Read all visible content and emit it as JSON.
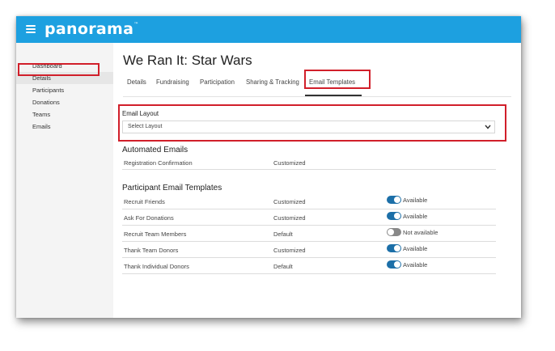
{
  "app": {
    "logo": "panorama",
    "logo_mark": "™"
  },
  "sidebar": {
    "items": [
      {
        "label": "Dashboard"
      },
      {
        "label": "Details"
      },
      {
        "label": "Participants"
      },
      {
        "label": "Donations"
      },
      {
        "label": "Teams"
      },
      {
        "label": "Emails"
      }
    ],
    "active": "Details"
  },
  "page": {
    "title": "We Ran It: Star Wars"
  },
  "tabs": [
    {
      "label": "Details"
    },
    {
      "label": "Fundraising"
    },
    {
      "label": "Participation"
    },
    {
      "label": "Sharing & Tracking"
    },
    {
      "label": "Email Templates"
    }
  ],
  "active_tab": "Email Templates",
  "email_layout": {
    "label": "Email Layout",
    "value": "Select Layout"
  },
  "automated": {
    "title": "Automated Emails",
    "rows": [
      {
        "name": "Registration Confirmation",
        "status": "Customized"
      }
    ]
  },
  "participant": {
    "title": "Participant Email Templates",
    "rows": [
      {
        "name": "Recruit Friends",
        "status": "Customized",
        "availability": "Available",
        "on": true
      },
      {
        "name": "Ask For Donations",
        "status": "Customized",
        "availability": "Available",
        "on": true
      },
      {
        "name": "Recruit Team Members",
        "status": "Default",
        "availability": "Not available",
        "on": false
      },
      {
        "name": "Thank Team Donors",
        "status": "Customized",
        "availability": "Available",
        "on": true
      },
      {
        "name": "Thank Individual Donors",
        "status": "Default",
        "availability": "Available",
        "on": true
      }
    ]
  },
  "colors": {
    "topbar": "#1da0e0",
    "highlight": "#d11f2a",
    "toggle_on": "#1c6fa8",
    "toggle_off": "#888888"
  }
}
